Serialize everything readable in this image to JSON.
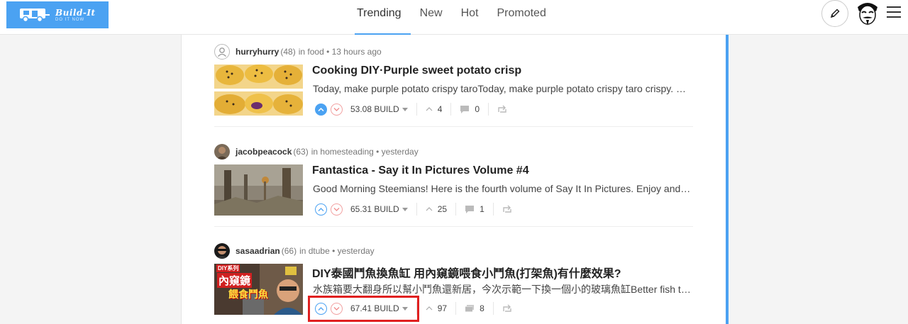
{
  "header": {
    "logo_title": "Build-It",
    "logo_subtitle": "DO IT NOW",
    "tabs": [
      {
        "label": "Trending",
        "active": true
      },
      {
        "label": "New",
        "active": false
      },
      {
        "label": "Hot",
        "active": false
      },
      {
        "label": "Promoted",
        "active": false
      }
    ],
    "icons": [
      "pencil-icon",
      "user-avatar",
      "menu-icon"
    ],
    "accent_color": "#4ba2f2"
  },
  "posts": [
    {
      "author": "hurryhurry",
      "reputation": "(48)",
      "category_prefix": "in",
      "category": "food",
      "time": "13 hours ago",
      "title": "Cooking DIY·Purple sweet potato crisp",
      "summary": "Today, make purple potato crispy taroToday, make purple potato crispy taro crispy. Purple potatoes are rich in",
      "payout": "53.08 BUILD",
      "votes": "4",
      "comments": "0",
      "upvoted": true
    },
    {
      "author": "jacobpeacock",
      "reputation": "(63)",
      "category_prefix": "in",
      "category": "homesteading",
      "time": "yesterday",
      "title": "Fantastica - Say it In Pictures Volume #4",
      "summary": "Good Morning Steemians! Here is the fourth volume of Say It In Pictures. Enjoy and have a great day",
      "payout": "65.31 BUILD",
      "votes": "25",
      "comments": "1",
      "upvoted": false
    },
    {
      "author": "sasaadrian",
      "reputation": "(66)",
      "category_prefix": "in",
      "category": "dtube",
      "time": "yesterday",
      "title": "DIY泰國鬥魚換魚缸 用內窺鏡喂食小鬥魚(打架魚)有什麼效果?",
      "summary": "水族箱要大翻身所以幫小鬥魚還新居，今次示範一下換一個小的玻璃魚缸Better fish tank for the betta",
      "payout": "67.41 BUILD",
      "votes": "97",
      "comments": "8",
      "upvoted": false,
      "thumb_overlay_small": "DIY系列",
      "thumb_overlay_line1": "內窺鏡",
      "thumb_overlay_line2": "餵食鬥魚"
    }
  ],
  "highlight_color": "#e02020"
}
